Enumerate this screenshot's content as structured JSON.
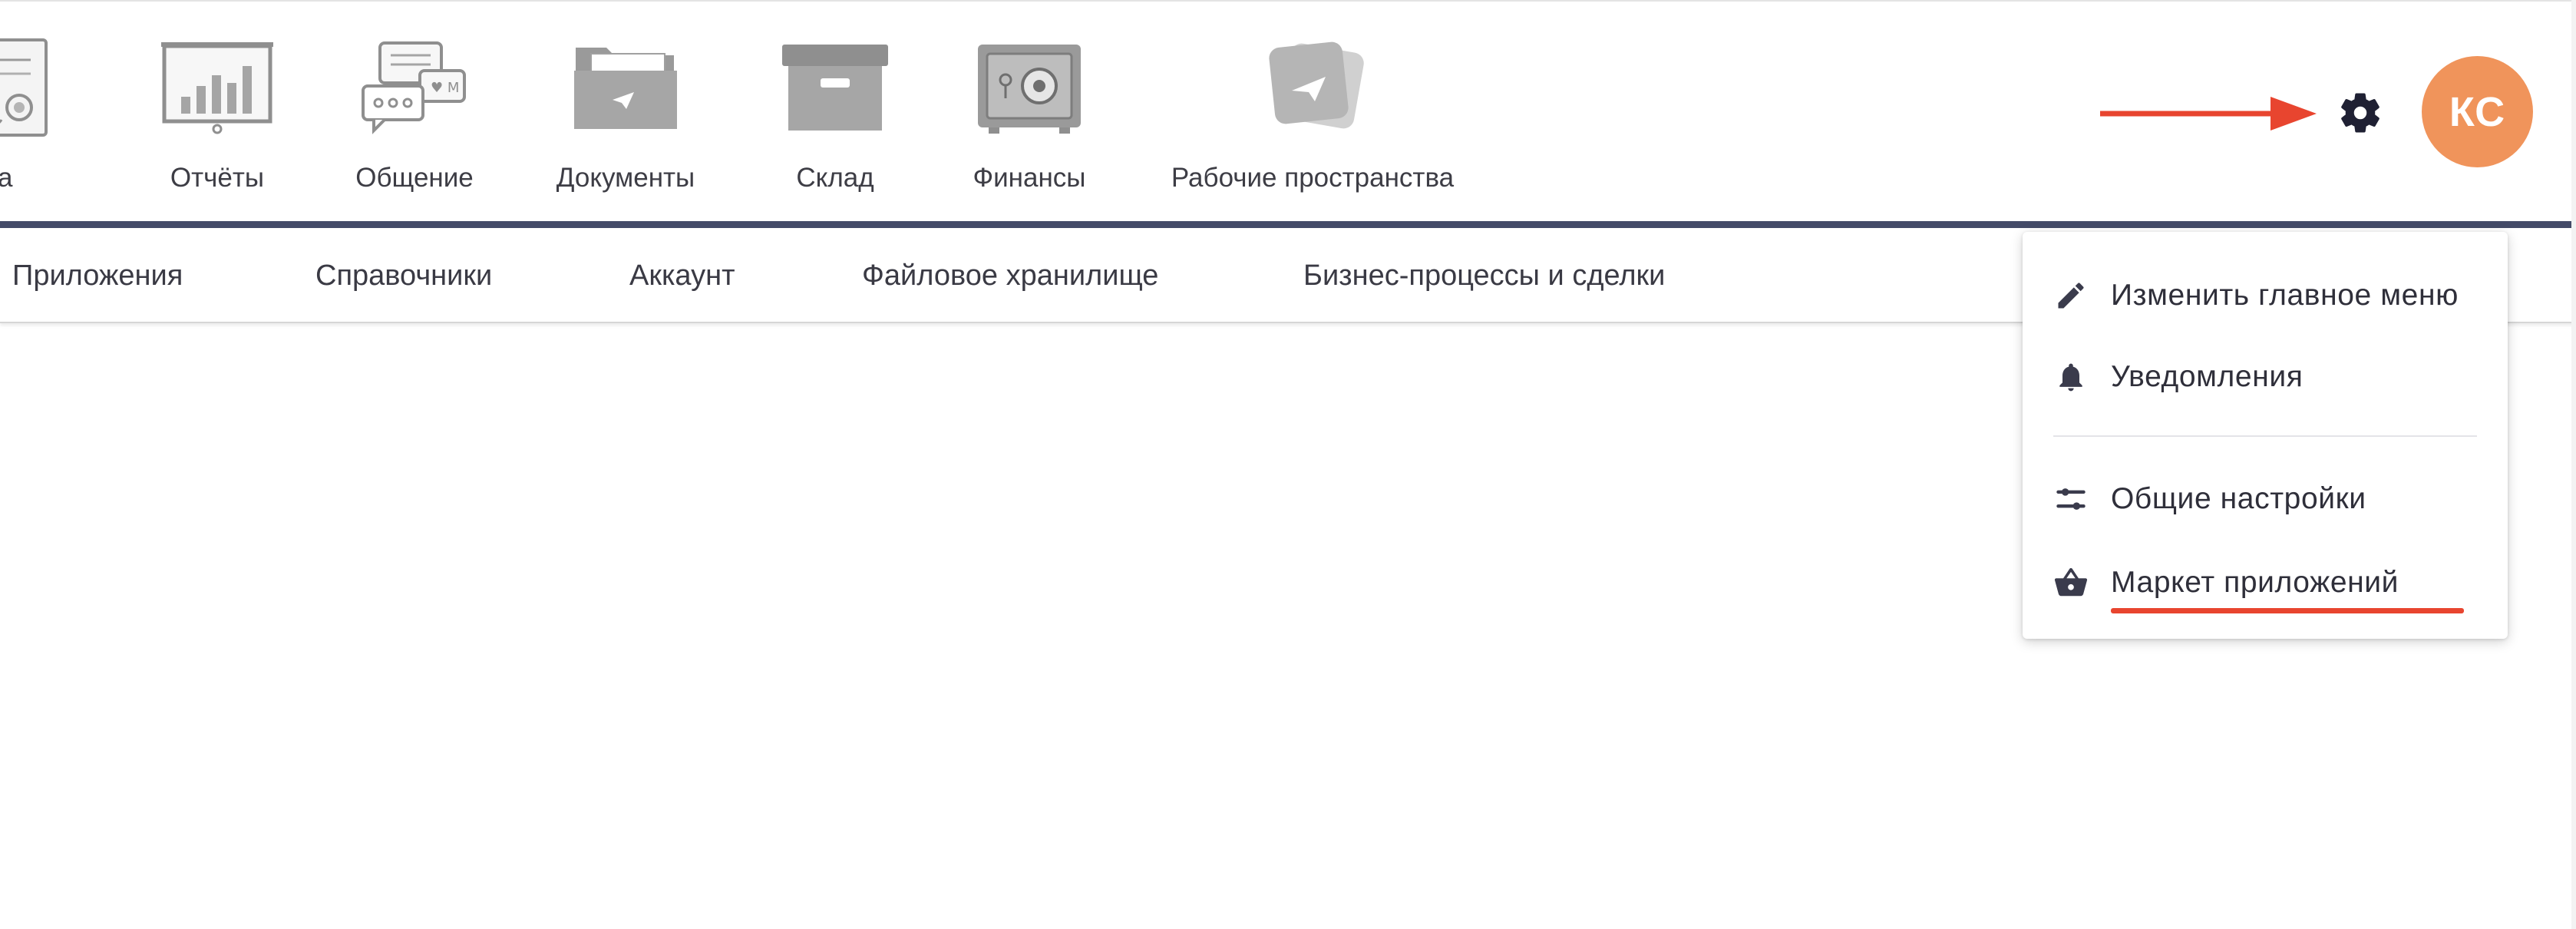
{
  "apps": {
    "schet": "Счета",
    "otchety": "Отчёты",
    "obshchenie": "Общение",
    "dokumenty": "Документы",
    "sklad": "Склад",
    "finansy": "Финансы",
    "rabochie": "Рабочие пространства"
  },
  "user": {
    "initials": "КС",
    "avatar_color": "#f0945b"
  },
  "subnav": {
    "items": [
      "Приложения",
      "Справочники",
      "Аккаунт",
      "Файловое хранилище",
      "Бизнес-процессы и сделки"
    ]
  },
  "settings_menu": {
    "items": [
      {
        "label": "Изменить главное меню",
        "icon": "pencil-icon"
      },
      {
        "label": "Уведомления",
        "icon": "bell-icon"
      },
      {
        "label": "Общие настройки",
        "icon": "sliders-icon"
      },
      {
        "label": "Маркет приложений",
        "icon": "basket-icon"
      }
    ]
  },
  "colors": {
    "accent_divider": "#444b68",
    "annotation_red": "#e8452f",
    "app_icon_gray": "#9a9a9a"
  }
}
